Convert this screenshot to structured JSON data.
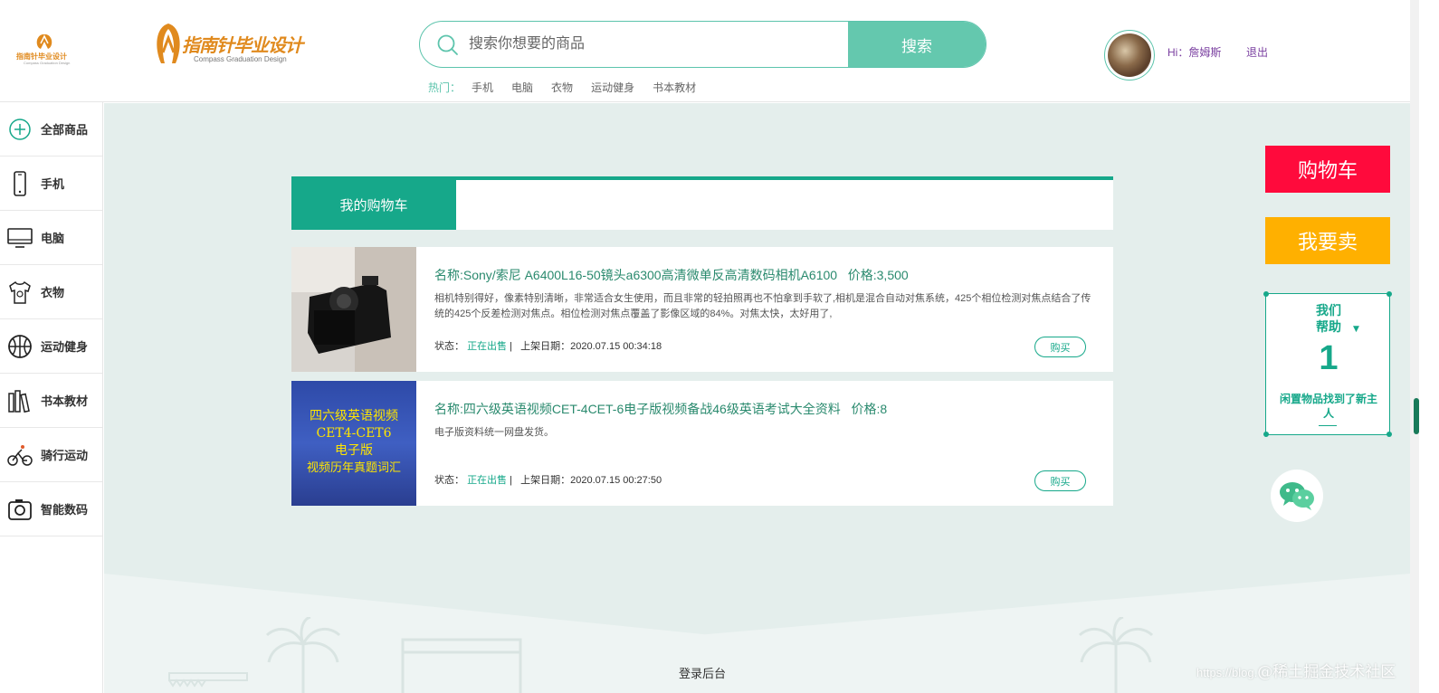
{
  "header": {
    "logo_small_text": "指南针毕业设计",
    "logo_small_sub": "Compass Graduation Design",
    "logo_text": "指南针毕业设计",
    "logo_sub": "Compass Graduation Design",
    "search_placeholder": "搜索你想要的商品",
    "search_button": "搜索",
    "hot_label": "热门：",
    "hot_items": [
      "手机",
      "电脑",
      "衣物",
      "运动健身",
      "书本教材"
    ],
    "user_greeting": "Hi：詹姆斯",
    "logout": "退出"
  },
  "sidebar": {
    "items": [
      {
        "label": "全部商品",
        "icon": "plus-circle-icon"
      },
      {
        "label": "手机",
        "icon": "phone-icon"
      },
      {
        "label": "电脑",
        "icon": "monitor-icon"
      },
      {
        "label": "衣物",
        "icon": "shirt-icon"
      },
      {
        "label": "运动健身",
        "icon": "ball-icon"
      },
      {
        "label": "书本教材",
        "icon": "books-icon"
      },
      {
        "label": "骑行运动",
        "icon": "cyclist-icon"
      },
      {
        "label": "智能数码",
        "icon": "camera-icon"
      }
    ]
  },
  "cart": {
    "tab_label": "我的购物车",
    "items": [
      {
        "title": "名称:Sony/索尼 A6400L16-50镜头a6300高清微单反高清数码相机A6100",
        "price": "价格:3,500",
        "desc": "相机特别得好，像素特别清晰，非常适合女生使用，而且非常的轻拍照再也不怕拿到手软了,相机是混合自动对焦系统，425个相位检测对焦点结合了传统的425个反差检测对焦点。相位检测对焦点覆盖了影像区域的84%。对焦太快，太好用了,",
        "status_label": "状态：",
        "status": "正在出售",
        "date_label": "上架日期：",
        "date": "2020.07.15 00:34:18",
        "buy": "购买"
      },
      {
        "title": "名称:四六级英语视频CET-4CET-6电子版视频备战46级英语考试大全资料",
        "price": "价格:8",
        "desc": "电子版资料统一网盘发货。",
        "status_label": "状态：",
        "status": "正在出售",
        "date_label": "上架日期：",
        "date": "2020.07.15 00:27:50",
        "buy": "购买",
        "thumb_lines": [
          "四六级英语视频",
          "CET4-CET6",
          "电子版",
          "视频历年真题词汇"
        ]
      }
    ]
  },
  "float": {
    "cart_button": "购物车",
    "sell_button": "我要卖",
    "help_title_1": "我们",
    "help_title_2": "帮助",
    "help_count": "1",
    "help_sub": "闲置物品找到了新主人"
  },
  "footer": {
    "admin_link": "登录后台"
  },
  "watermark": {
    "url": "https://blog.",
    "brand": "@稀土掘金技术社区"
  },
  "colors": {
    "accent": "#16a88a",
    "search_button": "#64c8ae",
    "cart_red": "#ff0a3c",
    "sell_yellow": "#ffb000",
    "logo_orange": "#e08a1e"
  }
}
